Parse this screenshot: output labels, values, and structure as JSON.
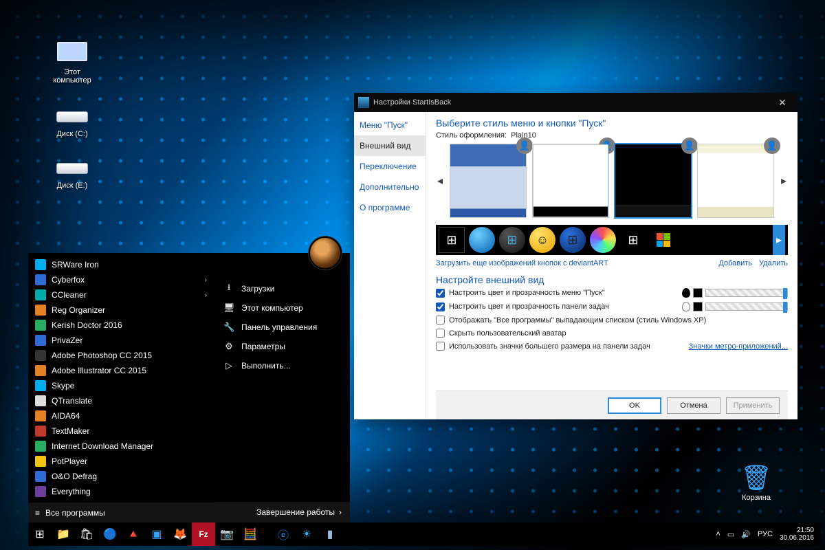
{
  "desktop": {
    "icons": [
      {
        "name": "this-pc",
        "label": "Этот\nкомпьютер"
      },
      {
        "name": "drive-c",
        "label": "Диск (C:)"
      },
      {
        "name": "drive-e",
        "label": "Диск (E:)"
      },
      {
        "name": "recycle-bin",
        "label": "Корзина"
      }
    ]
  },
  "startMenu": {
    "items": [
      {
        "label": "SRWare Iron",
        "color": "i-sky",
        "submenu": false
      },
      {
        "label": "Cyberfox",
        "color": "i-blue",
        "submenu": true
      },
      {
        "label": "CCleaner",
        "color": "i-teal",
        "submenu": true
      },
      {
        "label": "Reg Organizer",
        "color": "i-orange",
        "submenu": false
      },
      {
        "label": "Kerish Doctor 2016",
        "color": "i-green",
        "submenu": false
      },
      {
        "label": "PrivaZer",
        "color": "i-blue",
        "submenu": false
      },
      {
        "label": "Adobe Photoshop CC 2015",
        "color": "i-dark",
        "submenu": false
      },
      {
        "label": "Adobe Illustrator CC 2015",
        "color": "i-orange",
        "submenu": false
      },
      {
        "label": "Skype",
        "color": "i-sky",
        "submenu": false
      },
      {
        "label": "QTranslate",
        "color": "i-white",
        "submenu": false
      },
      {
        "label": "AIDA64",
        "color": "i-orange",
        "submenu": false
      },
      {
        "label": "TextMaker",
        "color": "i-red",
        "submenu": false
      },
      {
        "label": "Internet Download Manager",
        "color": "i-green",
        "submenu": false
      },
      {
        "label": "PotPlayer",
        "color": "i-yel",
        "submenu": false
      },
      {
        "label": "O&O Defrag",
        "color": "i-blue",
        "submenu": false
      },
      {
        "label": "Everything",
        "color": "i-purple",
        "submenu": false
      }
    ],
    "allPrograms": "Все программы",
    "system": [
      {
        "glyph": "⭳",
        "label": "Загрузки"
      },
      {
        "glyph": "🖥",
        "label": "Этот компьютер"
      },
      {
        "glyph": "🔧",
        "label": "Панель управления"
      },
      {
        "glyph": "⚙",
        "label": "Параметры"
      },
      {
        "glyph": "▷",
        "label": "Выполнить..."
      }
    ],
    "shutdown": "Завершение работы"
  },
  "window": {
    "title": "Настройки StartIsBack",
    "side": [
      "Меню \"Пуск\"",
      "Внешний вид",
      "Переключение",
      "Дополнительно",
      "О программе"
    ],
    "activeSide": 1,
    "heading1": "Выберите стиль меню и кнопки \"Пуск\"",
    "styleLabel": "Стиль оформления:",
    "styleValue": "Plain10",
    "deviantLink": "Загрузить еще изображений кнопок с deviantART",
    "addLink": "Добавить",
    "delLink": "Удалить",
    "heading2": "Настройте внешний вид",
    "opts": {
      "o1": "Настроить цвет и прозрачность меню \"Пуск\"",
      "o2": "Настроить цвет и прозрачность панели задач",
      "o3": "Отображать \"Все программы\" выпадающим списком (стиль Windows XP)",
      "o4": "Скрыть пользовательский аватар",
      "o5": "Использовать значки большего размера на панели задач"
    },
    "metroLink": "Значки метро-приложений...",
    "buttons": {
      "ok": "OK",
      "cancel": "Отмена",
      "apply": "Применить"
    }
  },
  "taskbar": {
    "lang": "РУС",
    "time": "21:50",
    "date": "30.06.2016"
  }
}
